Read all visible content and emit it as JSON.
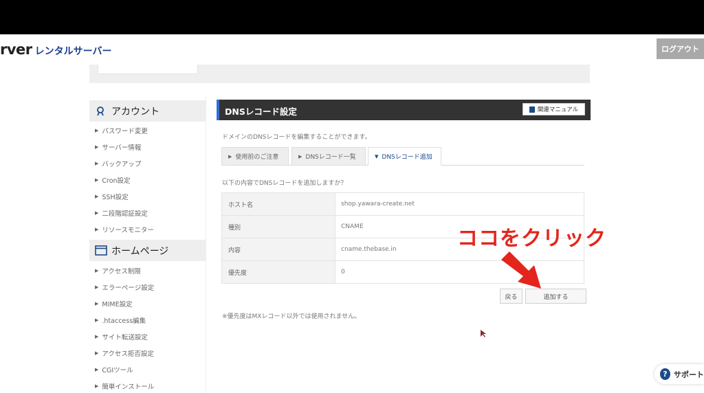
{
  "header": {
    "brand_latin": "rver",
    "brand_kana": "レンタルサーバー",
    "logout_label": "ログアウト"
  },
  "sidebar": {
    "sections": [
      {
        "title": "アカウント",
        "icon": "user-icon",
        "items": [
          "パスワード変更",
          "サーバー情報",
          "バックアップ",
          "Cron設定",
          "SSH設定",
          "二段階認証設定",
          "リソースモニター"
        ]
      },
      {
        "title": "ホームページ",
        "icon": "window-icon",
        "items": [
          "アクセス制限",
          "エラーページ設定",
          "MIME設定",
          ".htaccess編集",
          "サイト転送設定",
          "アクセス拒否設定",
          "CGIツール",
          "簡単インストール"
        ]
      }
    ]
  },
  "main": {
    "title": "DNSレコード設定",
    "manual_label": "関連マニュアル",
    "description": "ドメインのDNSレコードを編集することができます。",
    "tabs": [
      {
        "label": "使用前のご注意",
        "active": false
      },
      {
        "label": "DNSレコード一覧",
        "active": false
      },
      {
        "label": "DNSレコード追加",
        "active": true
      }
    ],
    "confirm_text": "以下の内容でDNSレコードを追加しますか？",
    "record": [
      {
        "label": "ホスト名",
        "value": "shop.yawara-create.net"
      },
      {
        "label": "種別",
        "value": "CNAME"
      },
      {
        "label": "内容",
        "value": "cname.thebase.in"
      },
      {
        "label": "優先度",
        "value": "0"
      }
    ],
    "back_label": "戻る",
    "add_label": "追加する",
    "note": "※優先度はMXレコード以外では使用されません。"
  },
  "annotation": {
    "text": "ココをクリック",
    "color": "#e3251c"
  },
  "support_label": "サポート",
  "colors": {
    "title_bar": "#333333",
    "accent_blue": "#1b4a8a",
    "logout_gray": "#a9a9a9"
  }
}
